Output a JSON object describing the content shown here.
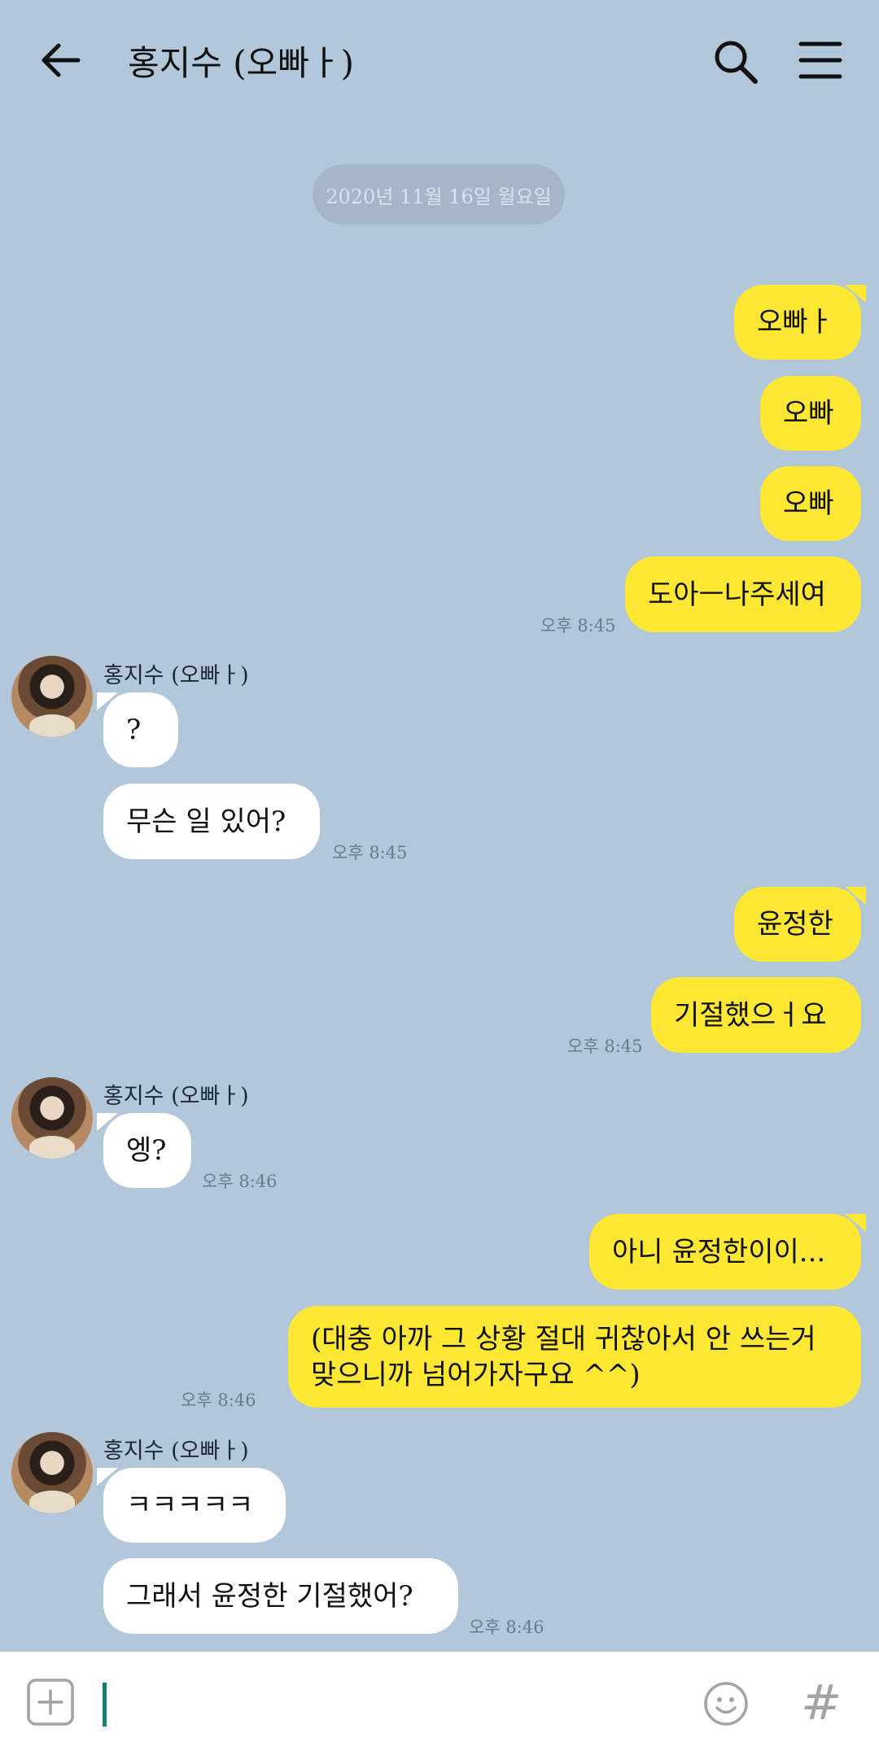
{
  "header": {
    "title": "홍지수 (오빠ㅏ)",
    "back_icon": "arrow-left-icon",
    "search_icon": "search-icon",
    "menu_icon": "hamburger-menu-icon"
  },
  "date_divider": "2020년 11월 16일 월요일",
  "messages": [
    {
      "from": "me",
      "text": "오빠ㅏ"
    },
    {
      "from": "me",
      "text": "오빠"
    },
    {
      "from": "me",
      "text": "오빠"
    },
    {
      "from": "me",
      "text": "도아ㅡ나주세여",
      "time": "오후 8:45"
    },
    {
      "from": "them",
      "sender": "홍지수 (오빠ㅏ)",
      "text": "?"
    },
    {
      "from": "them",
      "text": "무슨 일 있어?",
      "time": "오후 8:45"
    },
    {
      "from": "me",
      "text": "윤정한"
    },
    {
      "from": "me",
      "text": "기절했으ㅓ요",
      "time": "오후 8:45"
    },
    {
      "from": "them",
      "sender": "홍지수 (오빠ㅏ)",
      "text": "엥?",
      "time": "오후 8:46"
    },
    {
      "from": "me",
      "text": "아니 윤정한이이..."
    },
    {
      "from": "me",
      "line1": "(대충 아까 그 상황 절대 귀찮아서 안 쓰는거",
      "line2": "맞으니까 넘어가자구요 ^^)",
      "time": "오후 8:46"
    },
    {
      "from": "them",
      "sender": "홍지수 (오빠ㅏ)",
      "text": "ㅋㅋㅋㅋㅋ"
    },
    {
      "from": "them",
      "text": "그래서 윤정한 기절했어?",
      "time": "오후 8:46"
    }
  ],
  "input_bar": {
    "attach_icon": "plus-box-icon",
    "emoji_icon": "smiley-icon",
    "hashtag_icon": "hashtag-icon",
    "hashtag_symbol": "#"
  },
  "colors": {
    "background": "#b2c7da",
    "my_bubble": "#fee833",
    "their_bubble": "#ffffff",
    "cursor": "#157f74"
  }
}
